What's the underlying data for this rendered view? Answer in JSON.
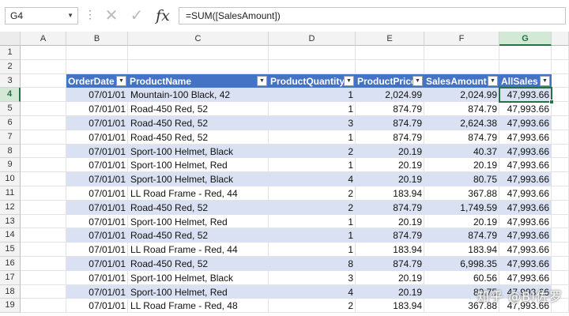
{
  "formula_bar": {
    "name_box": "G4",
    "formula": "=SUM([SalesAmount])",
    "cancel_icon": "cancel-icon",
    "enter_icon": "checkmark-icon",
    "fx_label": "fx"
  },
  "columns": [
    "A",
    "B",
    "C",
    "D",
    "E",
    "F",
    "G"
  ],
  "row_numbers": [
    "1",
    "2",
    "3",
    "4",
    "5",
    "6",
    "7",
    "8",
    "9",
    "10",
    "11",
    "12",
    "13",
    "14",
    "15",
    "16",
    "17",
    "18",
    "19"
  ],
  "table": {
    "headers": [
      "OrderDate",
      "ProductName",
      "ProductQuantity",
      "ProductPrice",
      "SalesAmount",
      "AllSales"
    ],
    "rows": [
      [
        "07/01/01",
        "Mountain-100 Black, 42",
        "1",
        "2,024.99",
        "2,024.99",
        "47,993.66"
      ],
      [
        "07/01/01",
        "Road-450 Red, 52",
        "1",
        "874.79",
        "874.79",
        "47,993.66"
      ],
      [
        "07/01/01",
        "Road-450 Red, 52",
        "3",
        "874.79",
        "2,624.38",
        "47,993.66"
      ],
      [
        "07/01/01",
        "Road-450 Red, 52",
        "1",
        "874.79",
        "874.79",
        "47,993.66"
      ],
      [
        "07/01/01",
        "Sport-100 Helmet, Black",
        "2",
        "20.19",
        "40.37",
        "47,993.66"
      ],
      [
        "07/01/01",
        "Sport-100 Helmet, Red",
        "1",
        "20.19",
        "20.19",
        "47,993.66"
      ],
      [
        "07/01/01",
        "Sport-100 Helmet, Black",
        "4",
        "20.19",
        "80.75",
        "47,993.66"
      ],
      [
        "07/01/01",
        "LL Road Frame - Red, 44",
        "2",
        "183.94",
        "367.88",
        "47,993.66"
      ],
      [
        "07/01/01",
        "Road-450 Red, 52",
        "2",
        "874.79",
        "1,749.59",
        "47,993.66"
      ],
      [
        "07/01/01",
        "Sport-100 Helmet, Red",
        "1",
        "20.19",
        "20.19",
        "47,993.66"
      ],
      [
        "07/01/01",
        "Road-450 Red, 52",
        "1",
        "874.79",
        "874.79",
        "47,993.66"
      ],
      [
        "07/01/01",
        "LL Road Frame - Red, 44",
        "1",
        "183.94",
        "183.94",
        "47,993.66"
      ],
      [
        "07/01/01",
        "Road-450 Red, 52",
        "8",
        "874.79",
        "6,998.35",
        "47,993.66"
      ],
      [
        "07/01/01",
        "Sport-100 Helmet, Black",
        "3",
        "20.19",
        "60.56",
        "47,993.66"
      ],
      [
        "07/01/01",
        "Sport-100 Helmet, Red",
        "4",
        "20.19",
        "80.75",
        "47,993.66"
      ],
      [
        "07/01/01",
        "LL Road Frame - Red, 48",
        "2",
        "183.94",
        "367.88",
        "47,993.66"
      ]
    ]
  },
  "active_cell": "G4",
  "watermark": "知乎 @BI佐罗",
  "colors": {
    "table_header": "#4472c4",
    "band": "#d9e1f2",
    "selection": "#217346"
  }
}
